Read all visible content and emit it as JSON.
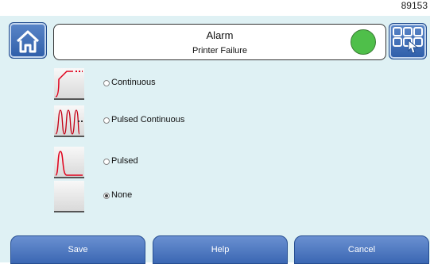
{
  "window": {
    "id_number": "89153"
  },
  "header": {
    "title": "Alarm",
    "subtitle": "Printer Failure",
    "status_color": "#4fbf4a"
  },
  "options": [
    {
      "label": "Continuous",
      "selected": false,
      "icon": "continuous-waveform-icon"
    },
    {
      "label": "Pulsed Continuous",
      "selected": false,
      "icon": "pulsed-continuous-waveform-icon"
    },
    {
      "label": "Pulsed",
      "selected": false,
      "icon": "pulsed-waveform-icon"
    },
    {
      "label": "None",
      "selected": true,
      "icon": "none-waveform-icon"
    }
  ],
  "footer": {
    "save_label": "Save",
    "help_label": "Help",
    "cancel_label": "Cancel"
  },
  "icons": {
    "home": "home-icon",
    "menu": "grid-menu-icon"
  },
  "colors": {
    "panel": "#dff1f4",
    "button": "#3b67b3",
    "signal": "#e0001b"
  }
}
